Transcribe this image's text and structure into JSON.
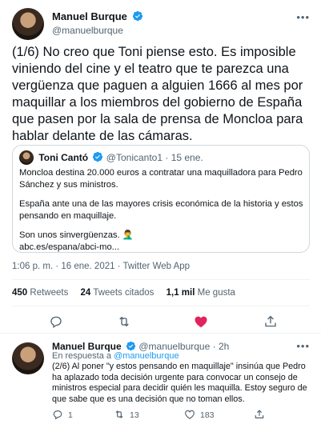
{
  "tweet": {
    "name": "Manuel Burque",
    "handle": "@manuelburque",
    "text": "(1/6) No creo que Toni piense esto. Es imposible viniendo del cine y el teatro que te parezca una vergüenza que paguen a alguien 1666 al mes por maquillar a los miembros del gobierno de España que pasen por la sala de prensa de Moncloa para hablar delante de las cámaras.",
    "meta": "1:06 p. m. · 16 ene. 2021 · Twitter Web App"
  },
  "quote": {
    "name": "Toni Cantó",
    "handle": "@Tonicanto1",
    "date": "· 15 ene.",
    "paragraphs": [
      "Moncloa destina 20.000 euros a contratar una maquilladora para Pedro Sánchez y sus ministros.",
      "España ante una de las mayores crisis económica de la historia y estos pensando en maquillaje.",
      "Son unos sinvergüenzas. 🤦‍♂️",
      "abc.es/espana/abci-mo..."
    ]
  },
  "stats": {
    "retweets_count": "450",
    "retweets_label": "Retweets",
    "quotes_count": "24",
    "quotes_label": "Tweets citados",
    "likes_count": "1,1 mil",
    "likes_label": "Me gusta"
  },
  "colors": {
    "like": "#e0245e",
    "icon": "#536471",
    "verified": "#1d9bf0"
  },
  "reply": {
    "name": "Manuel Burque",
    "handle": "@manuelburque",
    "time": "· 2h",
    "reply_prefix": "En respuesta a",
    "reply_to": "@manuelburque",
    "text": "(2/6) Al poner \"y estos pensando en maquillaje\" insinúa que Pedro ha aplazado toda decisión urgente para convocar un consejo de ministros especial para decidir quién les maquilla. Estoy seguro de que sabe que es una decisión  que no toman ellos.",
    "replies": "1",
    "retweets": "13",
    "likes": "183"
  }
}
